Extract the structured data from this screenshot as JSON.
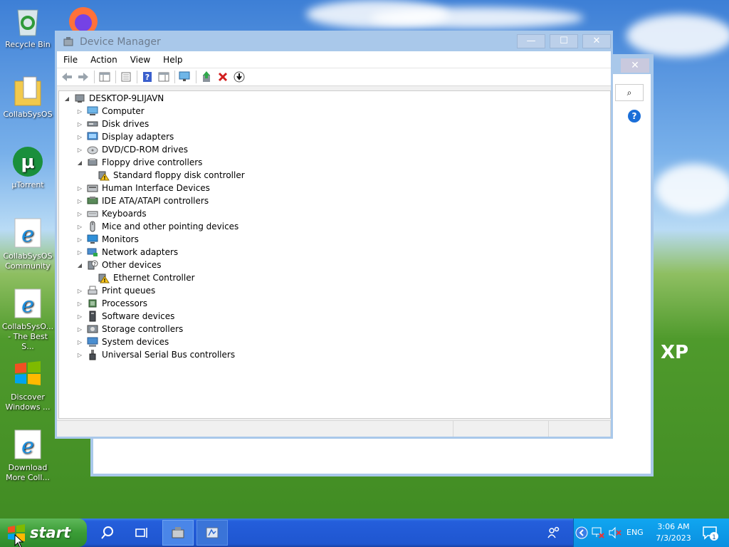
{
  "desktop": {
    "icons": [
      {
        "label": "Recycle Bin",
        "icon": "recycle-bin-icon"
      },
      {
        "label": "CollabSysOS",
        "icon": "folder-document-icon"
      },
      {
        "label": "µTorrent",
        "icon": "utorrent-icon"
      },
      {
        "label": "CollabSysOS Community",
        "icon": "internet-explorer-icon"
      },
      {
        "label": "CollabSysO... - The Best S...",
        "icon": "internet-explorer-icon"
      },
      {
        "label": "Discover Windows ...",
        "icon": "windows-flag-icon"
      },
      {
        "label": "Download More Coll...",
        "icon": "internet-explorer-icon"
      }
    ],
    "wallpaper_text": "XP"
  },
  "window": {
    "title": "Device Manager",
    "menu": [
      "File",
      "Action",
      "View",
      "Help"
    ],
    "tree": {
      "root": "DESKTOP-9LIJAVN",
      "nodes": [
        {
          "label": "Computer",
          "state": "collapsed",
          "icon": "computer-icon"
        },
        {
          "label": "Disk drives",
          "state": "collapsed",
          "icon": "disk-drive-icon"
        },
        {
          "label": "Display adapters",
          "state": "collapsed",
          "icon": "display-adapter-icon"
        },
        {
          "label": "DVD/CD-ROM drives",
          "state": "collapsed",
          "icon": "dvd-drive-icon"
        },
        {
          "label": "Floppy drive controllers",
          "state": "expanded",
          "icon": "controller-icon"
        },
        {
          "label": "Standard floppy disk controller",
          "state": "child-warning",
          "icon": "warning-device-icon"
        },
        {
          "label": "Human Interface Devices",
          "state": "collapsed",
          "icon": "hid-icon"
        },
        {
          "label": "IDE ATA/ATAPI controllers",
          "state": "collapsed",
          "icon": "ide-controller-icon"
        },
        {
          "label": "Keyboards",
          "state": "collapsed",
          "icon": "keyboard-icon"
        },
        {
          "label": "Mice and other pointing devices",
          "state": "collapsed",
          "icon": "mouse-icon"
        },
        {
          "label": "Monitors",
          "state": "collapsed",
          "icon": "monitor-icon"
        },
        {
          "label": "Network adapters",
          "state": "collapsed",
          "icon": "network-adapter-icon"
        },
        {
          "label": "Other devices",
          "state": "expanded",
          "icon": "unknown-device-icon"
        },
        {
          "label": "Ethernet Controller",
          "state": "child-warning",
          "icon": "warning-device-icon"
        },
        {
          "label": "Print queues",
          "state": "collapsed",
          "icon": "printer-icon"
        },
        {
          "label": "Processors",
          "state": "collapsed",
          "icon": "processor-icon"
        },
        {
          "label": "Software devices",
          "state": "collapsed",
          "icon": "software-device-icon"
        },
        {
          "label": "Storage controllers",
          "state": "collapsed",
          "icon": "storage-controller-icon"
        },
        {
          "label": "System devices",
          "state": "collapsed",
          "icon": "system-device-icon"
        },
        {
          "label": "Universal Serial Bus controllers",
          "state": "collapsed",
          "icon": "usb-icon"
        }
      ]
    }
  },
  "taskbar": {
    "start_label": "start",
    "language": "ENG",
    "time": "3:06 AM",
    "date": "7/3/2023",
    "notification_count": "1"
  },
  "colors": {
    "titlebar": "#a9c8ea",
    "taskbar": "#245edb",
    "start_button": "#3a9c36",
    "tray": "#0b8fe0"
  }
}
